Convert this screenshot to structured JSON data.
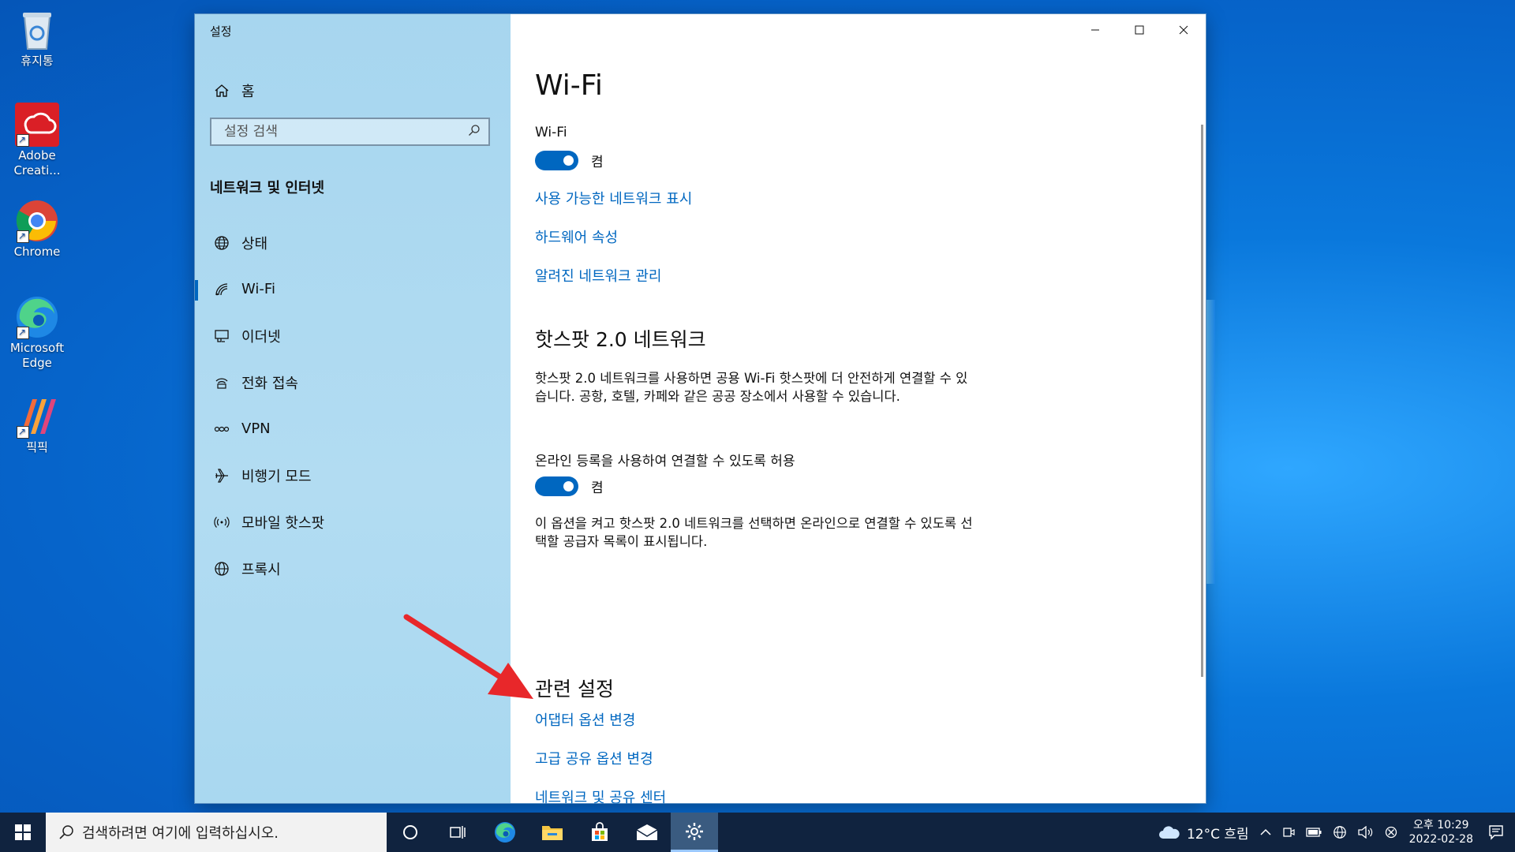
{
  "desktop": {
    "icons": [
      {
        "label": "휴지통"
      },
      {
        "label": "Adobe Creati..."
      },
      {
        "label": "Chrome"
      },
      {
        "label": "Microsoft Edge"
      },
      {
        "label": "픽픽"
      }
    ]
  },
  "window": {
    "title": "설정",
    "controls": [
      "minimize-icon",
      "maximize-icon",
      "close-icon"
    ]
  },
  "sidebar": {
    "home_label": "홈",
    "search_placeholder": "설정 검색",
    "section_title": "네트워크 및 인터넷",
    "items": [
      {
        "label": "상태",
        "icon": "status-globe-icon"
      },
      {
        "label": "Wi-Fi",
        "icon": "wifi-icon",
        "active": true
      },
      {
        "label": "이더넷",
        "icon": "ethernet-icon"
      },
      {
        "label": "전화 접속",
        "icon": "dialup-icon"
      },
      {
        "label": "VPN",
        "icon": "vpn-icon"
      },
      {
        "label": "비행기 모드",
        "icon": "airplane-icon"
      },
      {
        "label": "모바일 핫스팟",
        "icon": "hotspot-icon"
      },
      {
        "label": "프록시",
        "icon": "proxy-globe-icon"
      }
    ]
  },
  "main": {
    "title": "Wi-Fi",
    "wifi_label": "Wi-Fi",
    "wifi_toggle_state": "켬",
    "links1": [
      "사용 가능한 네트워크 표시",
      "하드웨어 속성",
      "알려진 네트워크 관리"
    ],
    "hotspot_heading": "핫스팟 2.0 네트워크",
    "hotspot_desc": "핫스팟 2.0 네트워크를 사용하면 공용 Wi-Fi 핫스팟에 더 안전하게 연결할 수 있습니다. 공항, 호텔, 카페와 같은 공공 장소에서 사용할 수 있습니다.",
    "online_label": "온라인 등록을 사용하여 연결할 수 있도록 허용",
    "online_toggle_state": "켬",
    "online_desc": "이 옵션을 켜고 핫스팟 2.0 네트워크를 선택하면 온라인으로 연결할 수 있도록 선택할 공급자 목록이 표시됩니다.",
    "related_heading": "관련 설정",
    "related_links": [
      "어댑터 옵션 변경",
      "고급 공유 옵션 변경",
      "네트워크 및 공유 센터"
    ]
  },
  "taskbar": {
    "search_placeholder": "검색하려면 여기에 입력하십시오.",
    "weather": "12°C 흐림",
    "time": "오후 10:29",
    "date": "2022-02-28"
  },
  "colors": {
    "accent": "#0067c0",
    "sidebar_bg": "#aad8f0",
    "taskbar_bg": "#10233f",
    "arrow": "#e8272a"
  }
}
